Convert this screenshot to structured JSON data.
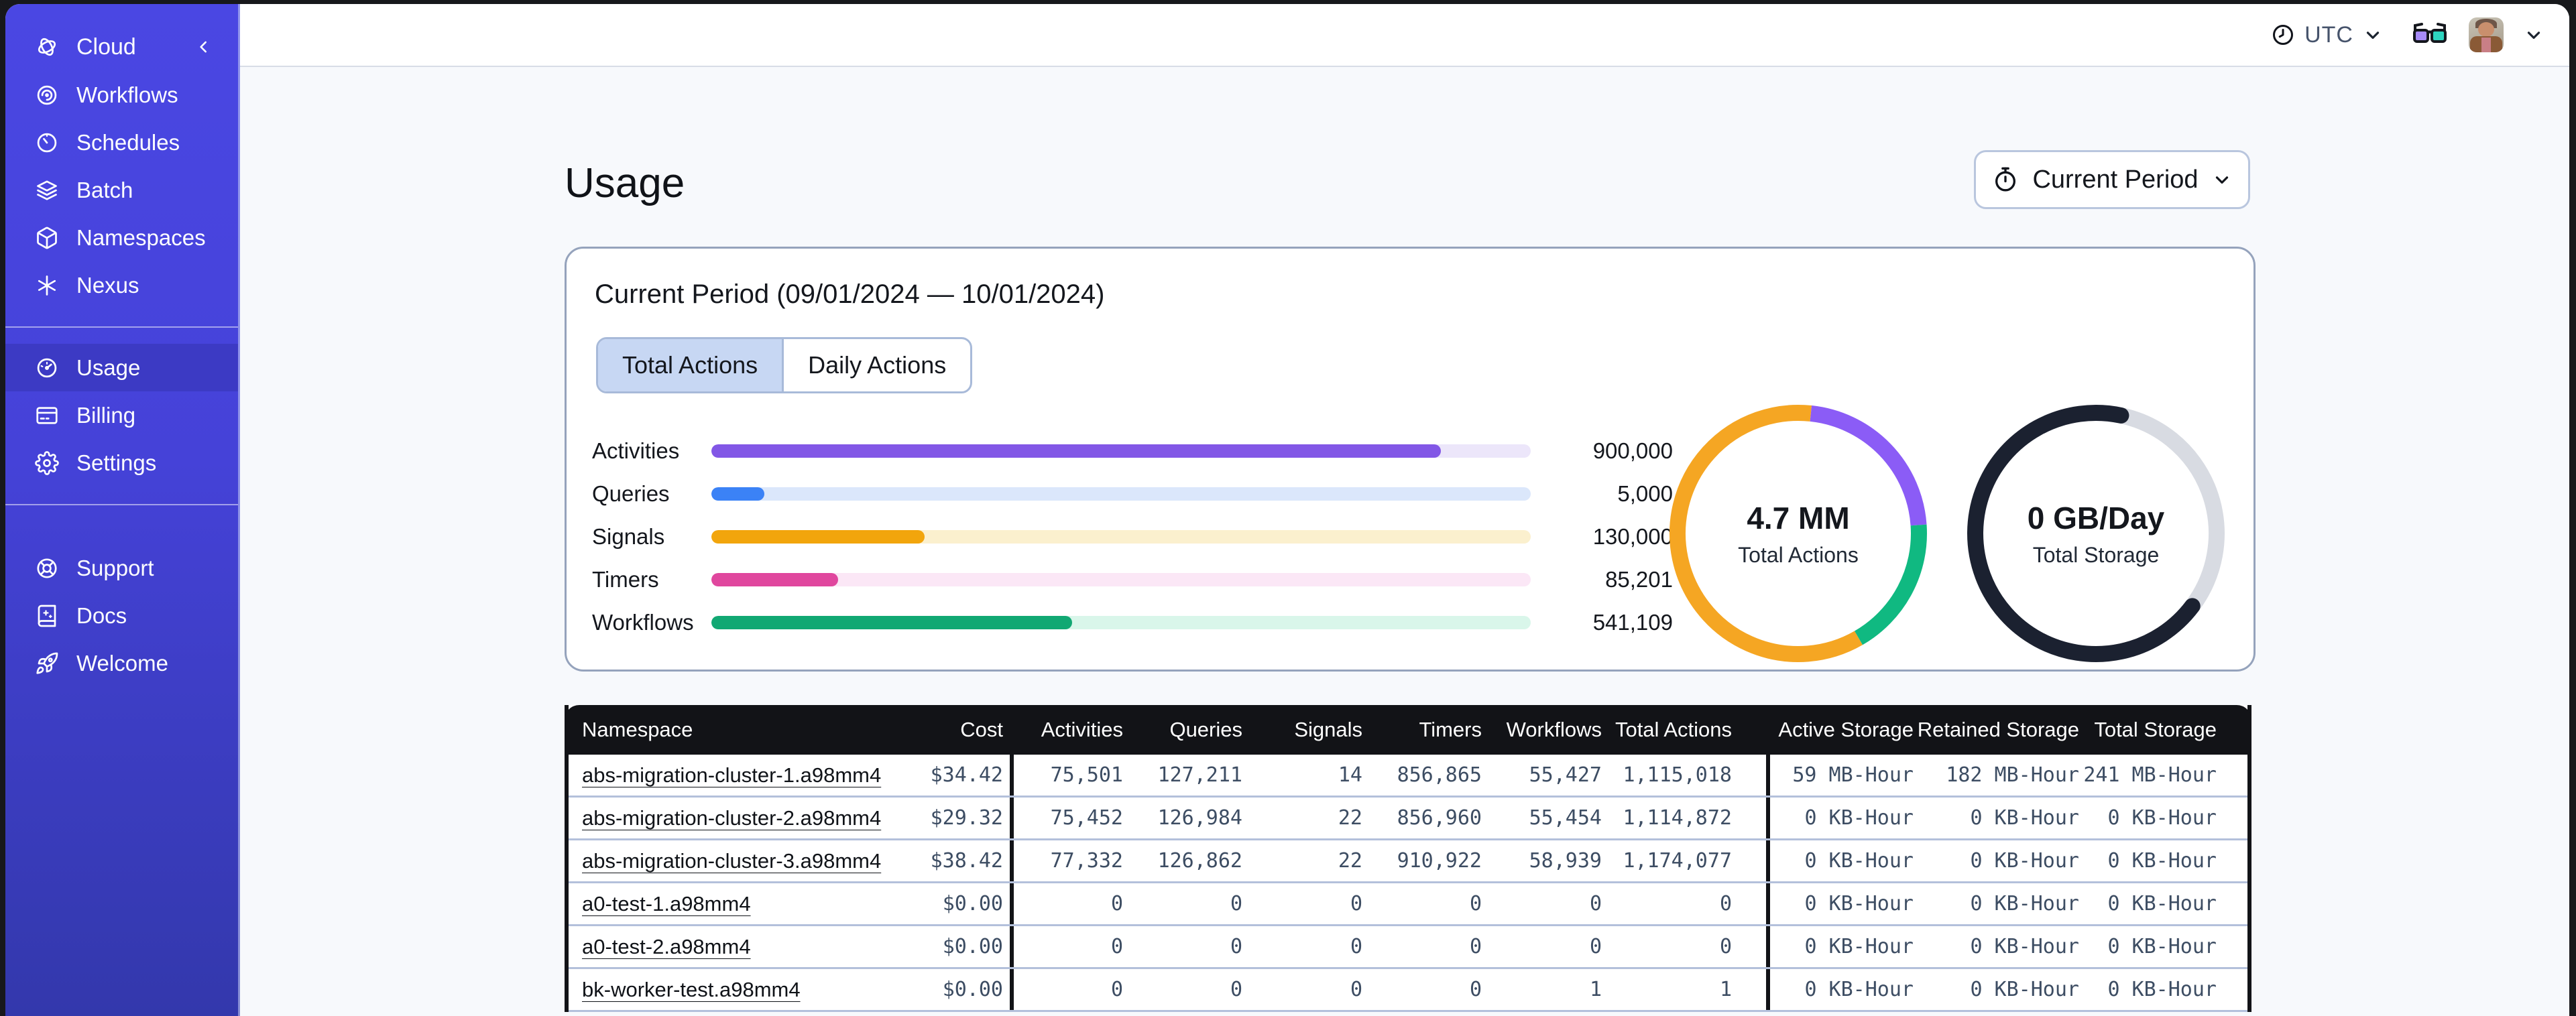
{
  "shell": {
    "timezone": "UTC"
  },
  "sidebar": {
    "brand": {
      "label": "Cloud",
      "icon": "temporal-logo"
    },
    "groups": [
      {
        "name": "main",
        "items": [
          {
            "id": "workflows",
            "label": "Workflows",
            "icon": "workflows",
            "active": false
          },
          {
            "id": "schedules",
            "label": "Schedules",
            "icon": "schedules",
            "active": false
          },
          {
            "id": "batch",
            "label": "Batch",
            "icon": "batch",
            "active": false
          },
          {
            "id": "namespaces",
            "label": "Namespaces",
            "icon": "namespaces",
            "active": false
          },
          {
            "id": "nexus",
            "label": "Nexus",
            "icon": "nexus",
            "active": false
          }
        ]
      },
      {
        "name": "account",
        "items": [
          {
            "id": "usage",
            "label": "Usage",
            "icon": "usage",
            "active": true
          },
          {
            "id": "billing",
            "label": "Billing",
            "icon": "billing",
            "active": false
          },
          {
            "id": "settings",
            "label": "Settings",
            "icon": "settings",
            "active": false
          }
        ]
      },
      {
        "name": "help",
        "items": [
          {
            "id": "support",
            "label": "Support",
            "icon": "support",
            "active": false
          },
          {
            "id": "docs",
            "label": "Docs",
            "icon": "docs",
            "active": false
          },
          {
            "id": "welcome",
            "label": "Welcome",
            "icon": "welcome",
            "active": false
          }
        ]
      }
    ]
  },
  "page": {
    "title": "Usage",
    "period_selector": {
      "label": "Current Period"
    }
  },
  "usage_card": {
    "title": "Current Period (09/01/2024 — 10/01/2024)",
    "tabs": [
      {
        "label": "Total Actions",
        "active": true
      },
      {
        "label": "Daily Actions",
        "active": false
      }
    ]
  },
  "chart_data": [
    {
      "type": "bar",
      "title": "Total Actions by type",
      "categories": [
        "Activities",
        "Queries",
        "Signals",
        "Timers",
        "Workflows"
      ],
      "values": [
        900000,
        5000,
        130000,
        85201,
        541109
      ],
      "value_labels": [
        "900,000",
        "5,000",
        "130,000",
        "85,201",
        "541,109"
      ],
      "fill_percents": [
        89,
        6.5,
        26,
        15.5,
        44
      ],
      "bar_colors": [
        "#8257e6",
        "#3b82f6",
        "#f2a50c",
        "#e0479e",
        "#11a873"
      ],
      "track_colors": [
        "#ece6fa",
        "#dbe7fb",
        "#fbf0ce",
        "#fbe7f6",
        "#d9f6ea"
      ]
    },
    {
      "type": "pie",
      "center_value": "4.7 MM",
      "center_label": "Total Actions",
      "segments": [
        {
          "name": "other-actions",
          "color": "#f5a623",
          "start_deg": 150,
          "end_deg": 366,
          "share_pct": 60
        },
        {
          "name": "activities",
          "color": "#8b5cf6",
          "start_deg": 6,
          "end_deg": 86,
          "share_pct": 22
        },
        {
          "name": "workflows",
          "color": "#10b981",
          "start_deg": 86,
          "end_deg": 150,
          "share_pct": 18
        }
      ]
    },
    {
      "type": "pie",
      "center_value": "0 GB/Day",
      "center_label": "Total Storage",
      "segments": [
        {
          "name": "free",
          "color": "#d8dbe2",
          "start_deg": 12,
          "end_deg": 127,
          "share_pct": 32,
          "cap": "butt"
        },
        {
          "name": "used",
          "color": "#1b2130",
          "start_deg": 127,
          "end_deg": 372,
          "share_pct": 68,
          "cap": "round"
        }
      ]
    }
  ],
  "table": {
    "headers": [
      "Namespace",
      "Cost",
      "Activities",
      "Queries",
      "Signals",
      "Timers",
      "Workflows",
      "Total Actions",
      "Active Storage",
      "Retained Storage",
      "Total Storage"
    ],
    "rows": [
      [
        "abs-migration-cluster-1.a98mm4",
        "$34.42",
        "75,501",
        "127,211",
        "14",
        "856,865",
        "55,427",
        "1,115,018",
        "59 MB-Hour",
        "182 MB-Hour",
        "241 MB-Hour"
      ],
      [
        "abs-migration-cluster-2.a98mm4",
        "$29.32",
        "75,452",
        "126,984",
        "22",
        "856,960",
        "55,454",
        "1,114,872",
        "0 KB-Hour",
        "0 KB-Hour",
        "0 KB-Hour"
      ],
      [
        "abs-migration-cluster-3.a98mm4",
        "$38.42",
        "77,332",
        "126,862",
        "22",
        "910,922",
        "58,939",
        "1,174,077",
        "0 KB-Hour",
        "0 KB-Hour",
        "0 KB-Hour"
      ],
      [
        "a0-test-1.a98mm4",
        "$0.00",
        "0",
        "0",
        "0",
        "0",
        "0",
        "0",
        "0 KB-Hour",
        "0 KB-Hour",
        "0 KB-Hour"
      ],
      [
        "a0-test-2.a98mm4",
        "$0.00",
        "0",
        "0",
        "0",
        "0",
        "0",
        "0",
        "0 KB-Hour",
        "0 KB-Hour",
        "0 KB-Hour"
      ],
      [
        "bk-worker-test.a98mm4",
        "$0.00",
        "0",
        "0",
        "0",
        "0",
        "1",
        "1",
        "0 KB-Hour",
        "0 KB-Hour",
        "0 KB-Hour"
      ]
    ]
  }
}
